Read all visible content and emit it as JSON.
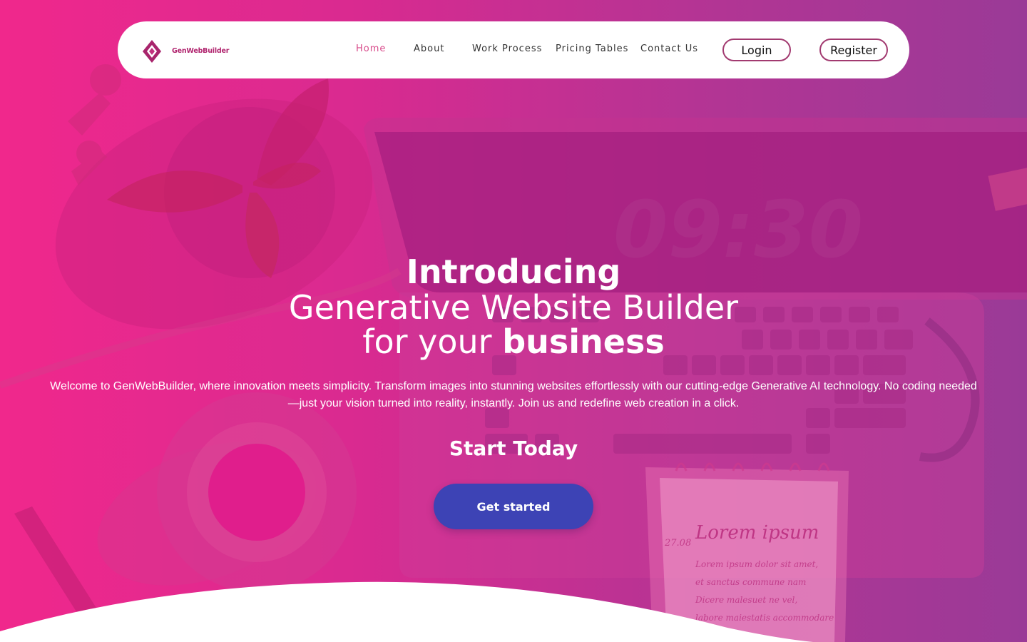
{
  "brand": {
    "name": "GenWebBuilder"
  },
  "nav": {
    "items": [
      {
        "label": "Home",
        "active": true
      },
      {
        "label": "About",
        "active": false
      },
      {
        "label": "Work Process",
        "active": false
      },
      {
        "label": "Pricing Tables",
        "active": false
      },
      {
        "label": "Contact Us",
        "active": false
      }
    ],
    "login_label": "Login",
    "register_label": "Register"
  },
  "hero": {
    "line1": "Introducing",
    "line2": "Generative Website Builder",
    "line3_prefix": "for your ",
    "line3_bold": "business",
    "description": "Welcome to GenWebBuilder, where innovation meets simplicity. Transform images into stunning websites effortlessly with our cutting-edge Generative AI technology. No coding needed—just your vision turned into reality, instantly. Join us and redefine web creation in a click.",
    "start_today": "Start Today",
    "cta_label": "Get started"
  },
  "background": {
    "clock_text": "09:30",
    "notepad_date": "27.08",
    "notepad_title": "Lorem ipsum",
    "notepad_lines": [
      "Lorem ipsum dolor sit amet,",
      "et sanctus commune nam",
      "Dicere malesuet ne vel,",
      "labore maiestatis accommodare"
    ]
  },
  "colors": {
    "gradient_start": "#f0288c",
    "gradient_end": "#9a3a97",
    "cta_bg": "#3d43b5",
    "nav_active": "#d84a8a",
    "brand": "#b0246e"
  }
}
